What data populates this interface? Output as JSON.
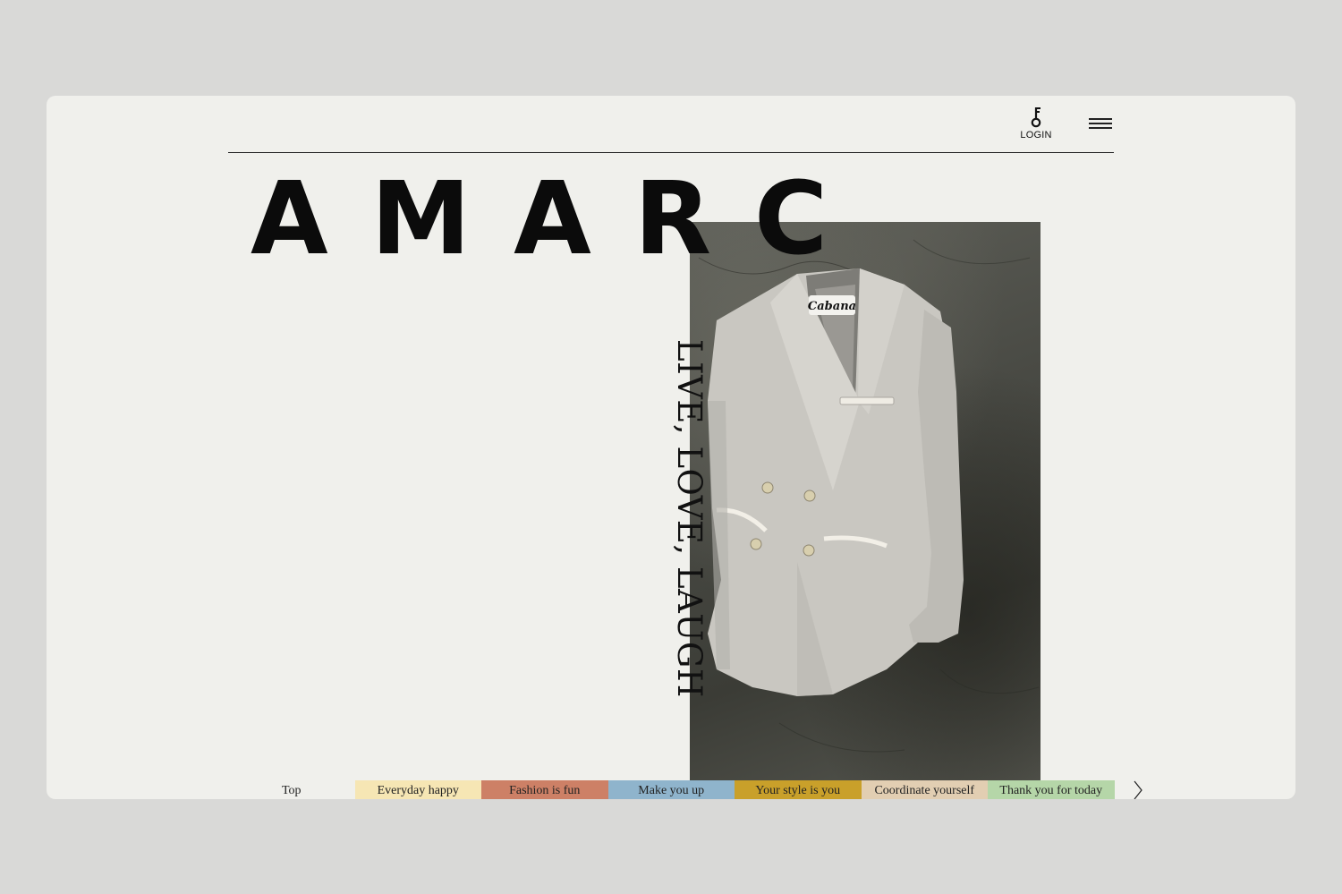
{
  "header": {
    "login_label": "LOGIN",
    "icons": {
      "login": "key-icon",
      "menu": "hamburger-menu-icon",
      "next": "chevron-right-icon"
    }
  },
  "hero": {
    "logo": "AMARC",
    "tagline": "LIVE, LOVE, LAUGH",
    "photo_label": "Cabana"
  },
  "tabs": [
    {
      "label": "Top",
      "color": "#f0f0ec"
    },
    {
      "label": "Everyday happy",
      "color": "#f6e6b4"
    },
    {
      "label": "Fashion is fun",
      "color": "#cd8066"
    },
    {
      "label": "Make you up",
      "color": "#8fb4cc"
    },
    {
      "label": "Your style is you",
      "color": "#c9a02a"
    },
    {
      "label": "Coordinate yourself",
      "color": "#e2ceb2"
    },
    {
      "label": "Thank you for today",
      "color": "#b5d6a8"
    }
  ]
}
